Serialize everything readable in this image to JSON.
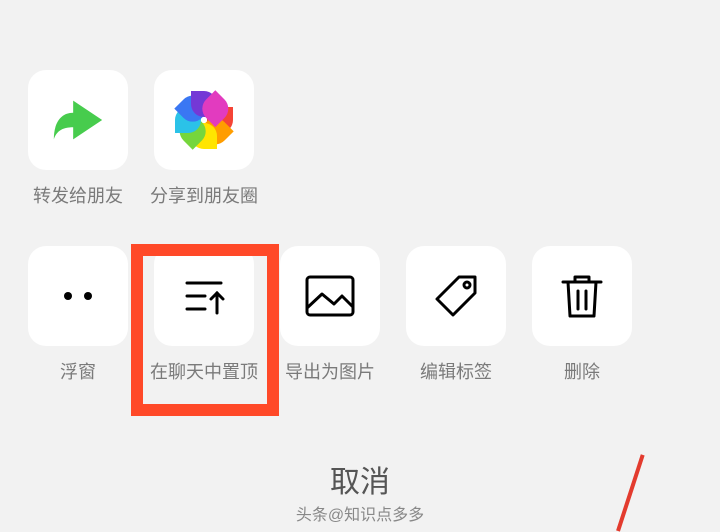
{
  "row1": {
    "items": [
      {
        "label": "转发给朋友",
        "icon": "forward-icon"
      },
      {
        "label": "分享到朋友圈",
        "icon": "moments-icon"
      }
    ]
  },
  "row2": {
    "items": [
      {
        "label": "浮窗",
        "icon": "float-window-icon"
      },
      {
        "label": "在聊天中置顶",
        "icon": "pin-top-icon"
      },
      {
        "label": "导出为图片",
        "icon": "export-image-icon"
      },
      {
        "label": "编辑标签",
        "icon": "edit-tag-icon"
      },
      {
        "label": "删除",
        "icon": "trash-icon"
      }
    ]
  },
  "cancel_label": "取消",
  "attribution": "头条@知识点多多",
  "highlighted_index": 1,
  "colors": {
    "highlight": "#ff4928",
    "forward_green": "#47cc4d"
  }
}
